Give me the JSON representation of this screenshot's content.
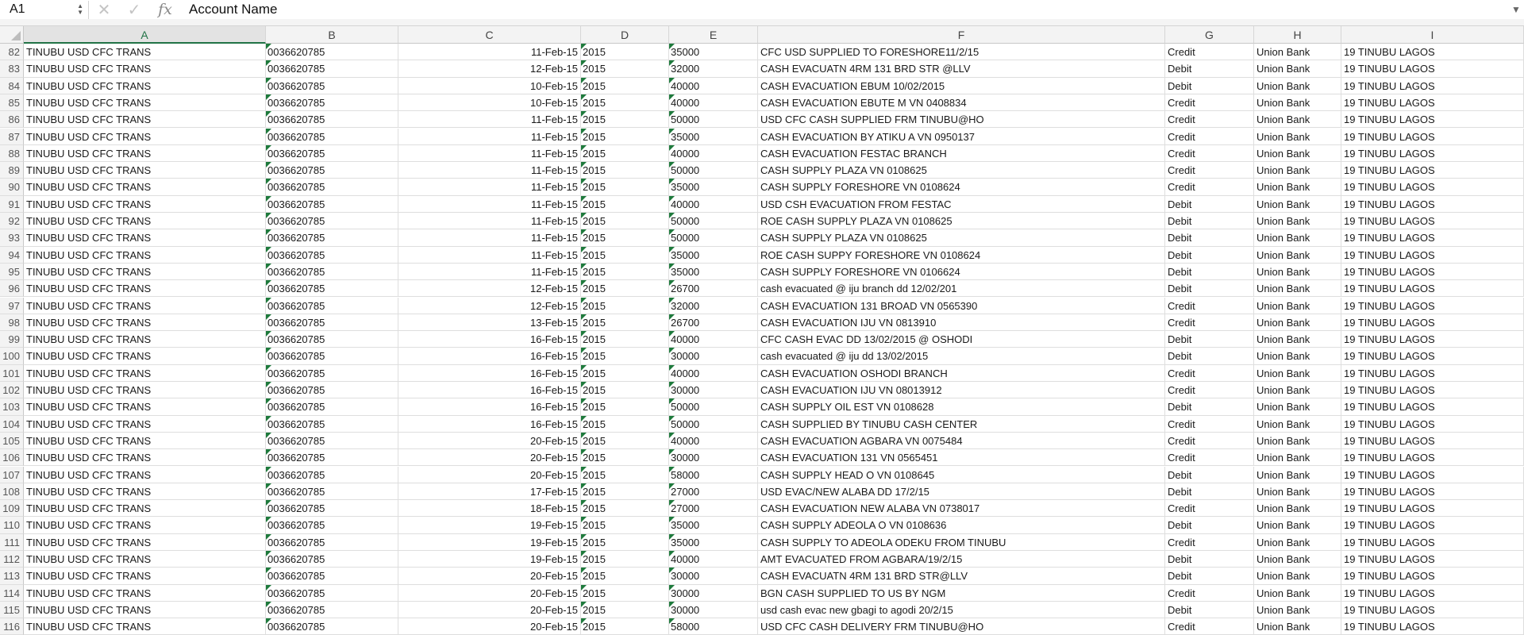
{
  "formula_bar": {
    "name_box": "A1",
    "cancel_icon": "✕",
    "enter_icon": "✓",
    "fx_label": "fx",
    "content": "Account Name"
  },
  "columns": [
    "A",
    "B",
    "C",
    "D",
    "E",
    "F",
    "G",
    "H",
    "I"
  ],
  "active_column": "A",
  "rows": [
    {
      "n": "82",
      "a": "TINUBU USD CFC TRANS",
      "b": "0036620785",
      "c": "11-Feb-15",
      "d": "2015",
      "e": "35000",
      "f": "CFC USD SUPPLIED TO FORESHORE11/2/15",
      "g": "Credit",
      "h": "Union Bank",
      "i": "19 TINUBU LAGOS"
    },
    {
      "n": "83",
      "a": "TINUBU USD CFC TRANS",
      "b": "0036620785",
      "c": "12-Feb-15",
      "d": "2015",
      "e": "32000",
      "f": "CASH EVACUATN 4RM 131 BRD STR @LLV",
      "g": "Debit",
      "h": "Union Bank",
      "i": "19 TINUBU LAGOS"
    },
    {
      "n": "84",
      "a": "TINUBU USD CFC TRANS",
      "b": "0036620785",
      "c": "10-Feb-15",
      "d": "2015",
      "e": "40000",
      "f": "CASH EVACUATION EBUM 10/02/2015",
      "g": "Debit",
      "h": "Union Bank",
      "i": "19 TINUBU LAGOS"
    },
    {
      "n": "85",
      "a": "TINUBU USD CFC TRANS",
      "b": "0036620785",
      "c": "10-Feb-15",
      "d": "2015",
      "e": "40000",
      "f": "CASH EVACUATION EBUTE M VN 0408834",
      "g": "Credit",
      "h": "Union Bank",
      "i": "19 TINUBU LAGOS"
    },
    {
      "n": "86",
      "a": "TINUBU USD CFC TRANS",
      "b": "0036620785",
      "c": "11-Feb-15",
      "d": "2015",
      "e": "50000",
      "f": "USD CFC CASH SUPPLIED FRM TINUBU@HO",
      "g": "Credit",
      "h": "Union Bank",
      "i": "19 TINUBU LAGOS"
    },
    {
      "n": "87",
      "a": "TINUBU USD CFC TRANS",
      "b": "0036620785",
      "c": "11-Feb-15",
      "d": "2015",
      "e": "35000",
      "f": "CASH EVACUATION BY ATIKU A VN 0950137",
      "g": "Credit",
      "h": "Union Bank",
      "i": "19 TINUBU LAGOS"
    },
    {
      "n": "88",
      "a": "TINUBU USD CFC TRANS",
      "b": "0036620785",
      "c": "11-Feb-15",
      "d": "2015",
      "e": "40000",
      "f": "CASH EVACUATION FESTAC BRANCH",
      "g": "Credit",
      "h": "Union Bank",
      "i": "19 TINUBU LAGOS"
    },
    {
      "n": "89",
      "a": "TINUBU USD CFC TRANS",
      "b": "0036620785",
      "c": "11-Feb-15",
      "d": "2015",
      "e": "50000",
      "f": "CASH SUPPLY PLAZA VN 0108625",
      "g": "Credit",
      "h": "Union Bank",
      "i": "19 TINUBU LAGOS"
    },
    {
      "n": "90",
      "a": "TINUBU USD CFC TRANS",
      "b": "0036620785",
      "c": "11-Feb-15",
      "d": "2015",
      "e": "35000",
      "f": "CASH SUPPLY FORESHORE VN 0108624",
      "g": "Credit",
      "h": "Union Bank",
      "i": "19 TINUBU LAGOS"
    },
    {
      "n": "91",
      "a": "TINUBU USD CFC TRANS",
      "b": "0036620785",
      "c": "11-Feb-15",
      "d": "2015",
      "e": "40000",
      "f": "USD CSH EVACUATION FROM FESTAC",
      "g": "Debit",
      "h": "Union Bank",
      "i": "19 TINUBU LAGOS"
    },
    {
      "n": "92",
      "a": "TINUBU USD CFC TRANS",
      "b": "0036620785",
      "c": "11-Feb-15",
      "d": "2015",
      "e": "50000",
      "f": "ROE CASH SUPPLY PLAZA VN 0108625",
      "g": "Debit",
      "h": "Union Bank",
      "i": "19 TINUBU LAGOS"
    },
    {
      "n": "93",
      "a": "TINUBU USD CFC TRANS",
      "b": "0036620785",
      "c": "11-Feb-15",
      "d": "2015",
      "e": "50000",
      "f": "CASH SUPPLY PLAZA VN 0108625",
      "g": "Debit",
      "h": "Union Bank",
      "i": "19 TINUBU LAGOS"
    },
    {
      "n": "94",
      "a": "TINUBU USD CFC TRANS",
      "b": "0036620785",
      "c": "11-Feb-15",
      "d": "2015",
      "e": "35000",
      "f": "ROE CASH SUPPY FORESHORE VN 0108624",
      "g": "Debit",
      "h": "Union Bank",
      "i": "19 TINUBU LAGOS"
    },
    {
      "n": "95",
      "a": "TINUBU USD CFC TRANS",
      "b": "0036620785",
      "c": "11-Feb-15",
      "d": "2015",
      "e": "35000",
      "f": "CASH SUPPLY FORESHORE VN 0106624",
      "g": "Debit",
      "h": "Union Bank",
      "i": "19 TINUBU LAGOS"
    },
    {
      "n": "96",
      "a": "TINUBU USD CFC TRANS",
      "b": "0036620785",
      "c": "12-Feb-15",
      "d": "2015",
      "e": "26700",
      "f": "cash evacuated @ iju branch dd 12/02/201",
      "g": "Debit",
      "h": "Union Bank",
      "i": "19 TINUBU LAGOS"
    },
    {
      "n": "97",
      "a": "TINUBU USD CFC TRANS",
      "b": "0036620785",
      "c": "12-Feb-15",
      "d": "2015",
      "e": "32000",
      "f": "CASH EVACUATION 131 BROAD VN 0565390",
      "g": "Credit",
      "h": "Union Bank",
      "i": "19 TINUBU LAGOS"
    },
    {
      "n": "98",
      "a": "TINUBU USD CFC TRANS",
      "b": "0036620785",
      "c": "13-Feb-15",
      "d": "2015",
      "e": "26700",
      "f": "CASH EVACUATION IJU VN 0813910",
      "g": "Credit",
      "h": "Union Bank",
      "i": "19 TINUBU LAGOS"
    },
    {
      "n": "99",
      "a": "TINUBU USD CFC TRANS",
      "b": "0036620785",
      "c": "16-Feb-15",
      "d": "2015",
      "e": "40000",
      "f": "CFC CASH EVAC DD 13/02/2015 @ OSHODI",
      "g": "Debit",
      "h": "Union Bank",
      "i": "19 TINUBU LAGOS"
    },
    {
      "n": "100",
      "a": "TINUBU USD CFC TRANS",
      "b": "0036620785",
      "c": "16-Feb-15",
      "d": "2015",
      "e": "30000",
      "f": "cash evacuated @ iju dd 13/02/2015",
      "g": "Debit",
      "h": "Union Bank",
      "i": "19 TINUBU LAGOS"
    },
    {
      "n": "101",
      "a": "TINUBU USD CFC TRANS",
      "b": "0036620785",
      "c": "16-Feb-15",
      "d": "2015",
      "e": "40000",
      "f": "CASH EVACUATION OSHODI BRANCH",
      "g": "Credit",
      "h": "Union Bank",
      "i": "19 TINUBU LAGOS"
    },
    {
      "n": "102",
      "a": "TINUBU USD CFC TRANS",
      "b": "0036620785",
      "c": "16-Feb-15",
      "d": "2015",
      "e": "30000",
      "f": "CASH EVACUATION IJU VN 08013912",
      "g": "Credit",
      "h": "Union Bank",
      "i": "19 TINUBU LAGOS"
    },
    {
      "n": "103",
      "a": "TINUBU USD CFC TRANS",
      "b": "0036620785",
      "c": "16-Feb-15",
      "d": "2015",
      "e": "50000",
      "f": "CASH SUPPLY OIL EST VN 0108628",
      "g": "Debit",
      "h": "Union Bank",
      "i": "19 TINUBU LAGOS"
    },
    {
      "n": "104",
      "a": "TINUBU USD CFC TRANS",
      "b": "0036620785",
      "c": "16-Feb-15",
      "d": "2015",
      "e": "50000",
      "f": "CASH SUPPLIED  BY TINUBU  CASH CENTER",
      "g": "Credit",
      "h": "Union Bank",
      "i": "19 TINUBU LAGOS"
    },
    {
      "n": "105",
      "a": "TINUBU USD CFC TRANS",
      "b": "0036620785",
      "c": "20-Feb-15",
      "d": "2015",
      "e": "40000",
      "f": "CASH EVACUATION AGBARA VN 0075484",
      "g": "Credit",
      "h": "Union Bank",
      "i": "19 TINUBU LAGOS"
    },
    {
      "n": "106",
      "a": "TINUBU USD CFC TRANS",
      "b": "0036620785",
      "c": "20-Feb-15",
      "d": "2015",
      "e": "30000",
      "f": "CASH EVACUATION 131 VN 0565451",
      "g": "Credit",
      "h": "Union Bank",
      "i": "19 TINUBU LAGOS"
    },
    {
      "n": "107",
      "a": "TINUBU USD CFC TRANS",
      "b": "0036620785",
      "c": "20-Feb-15",
      "d": "2015",
      "e": "58000",
      "f": "CASH SUPPLY HEAD O VN 0108645",
      "g": "Debit",
      "h": "Union Bank",
      "i": "19 TINUBU LAGOS"
    },
    {
      "n": "108",
      "a": "TINUBU USD CFC TRANS",
      "b": "0036620785",
      "c": "17-Feb-15",
      "d": "2015",
      "e": "27000",
      "f": "USD EVAC/NEW ALABA DD 17/2/15",
      "g": "Debit",
      "h": "Union Bank",
      "i": "19 TINUBU LAGOS"
    },
    {
      "n": "109",
      "a": "TINUBU USD CFC TRANS",
      "b": "0036620785",
      "c": "18-Feb-15",
      "d": "2015",
      "e": "27000",
      "f": "CASH EVACUATION NEW ALABA VN 0738017",
      "g": "Credit",
      "h": "Union Bank",
      "i": "19 TINUBU LAGOS"
    },
    {
      "n": "110",
      "a": "TINUBU USD CFC TRANS",
      "b": "0036620785",
      "c": "19-Feb-15",
      "d": "2015",
      "e": "35000",
      "f": "CASH SUPPLY ADEOLA O VN 0108636",
      "g": "Debit",
      "h": "Union Bank",
      "i": "19 TINUBU LAGOS"
    },
    {
      "n": "111",
      "a": "TINUBU USD CFC TRANS",
      "b": "0036620785",
      "c": "19-Feb-15",
      "d": "2015",
      "e": "35000",
      "f": "CASH SUPPLY TO ADEOLA ODEKU FROM TINUBU",
      "g": "Credit",
      "h": "Union Bank",
      "i": "19 TINUBU LAGOS"
    },
    {
      "n": "112",
      "a": "TINUBU USD CFC TRANS",
      "b": "0036620785",
      "c": "19-Feb-15",
      "d": "2015",
      "e": "40000",
      "f": "AMT EVACUATED FROM AGBARA/19/2/15",
      "g": "Debit",
      "h": "Union Bank",
      "i": "19 TINUBU LAGOS"
    },
    {
      "n": "113",
      "a": "TINUBU USD CFC TRANS",
      "b": "0036620785",
      "c": "20-Feb-15",
      "d": "2015",
      "e": "30000",
      "f": "CASH EVACUATN 4RM 131 BRD STR@LLV",
      "g": "Debit",
      "h": "Union Bank",
      "i": "19 TINUBU LAGOS"
    },
    {
      "n": "114",
      "a": "TINUBU USD CFC TRANS",
      "b": "0036620785",
      "c": "20-Feb-15",
      "d": "2015",
      "e": "30000",
      "f": "BGN CASH SUPPLIED TO US BY NGM",
      "g": "Credit",
      "h": "Union Bank",
      "i": "19 TINUBU LAGOS"
    },
    {
      "n": "115",
      "a": "TINUBU USD CFC TRANS",
      "b": "0036620785",
      "c": "20-Feb-15",
      "d": "2015",
      "e": "30000",
      "f": "usd cash evac new gbagi to agodi 20/2/15",
      "g": "Debit",
      "h": "Union Bank",
      "i": "19 TINUBU LAGOS"
    },
    {
      "n": "116",
      "a": "TINUBU USD CFC TRANS",
      "b": "0036620785",
      "c": "20-Feb-15",
      "d": "2015",
      "e": "58000",
      "f": "USD CFC CASH DELIVERY FRM TINUBU@HO",
      "g": "Credit",
      "h": "Union Bank",
      "i": "19 TINUBU LAGOS"
    }
  ]
}
